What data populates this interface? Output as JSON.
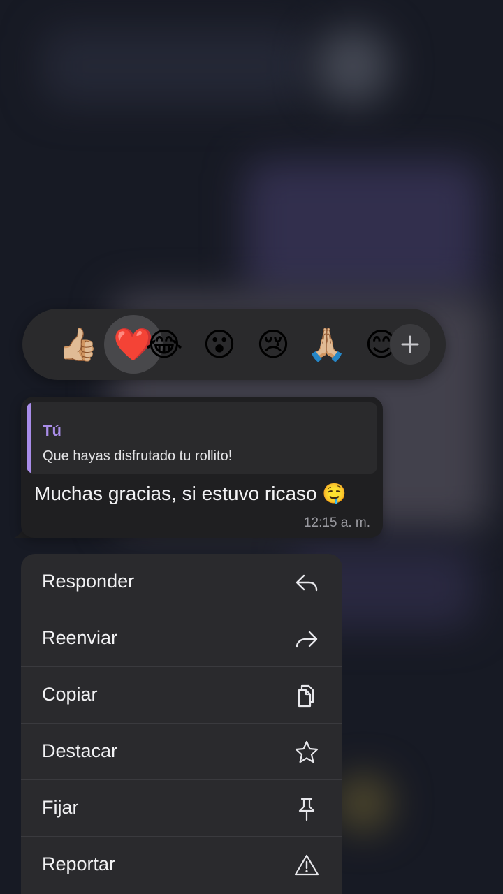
{
  "reactions": {
    "items": [
      {
        "emoji": "👍🏼",
        "name": "thumbs-up-icon",
        "selected": false
      },
      {
        "emoji": "❤️",
        "name": "heart-icon",
        "selected": true
      },
      {
        "emoji": "😂",
        "name": "laughing-icon",
        "selected": false
      },
      {
        "emoji": "😮",
        "name": "surprised-icon",
        "selected": false
      },
      {
        "emoji": "😢",
        "name": "crying-icon",
        "selected": false
      },
      {
        "emoji": "🙏🏼",
        "name": "praying-hands-icon",
        "selected": false
      },
      {
        "emoji": "😊",
        "name": "partial-emoji-icon",
        "selected": false
      }
    ],
    "more_icon": "plus-icon"
  },
  "message": {
    "quote_author": "Tú",
    "quote_text": "Que hayas disfrutado tu rollito!",
    "text": "Muchas gracias, si estuvo ricaso 🤤",
    "time": "12:15 a. m."
  },
  "menu": {
    "items": [
      {
        "label": "Responder",
        "icon": "reply-icon"
      },
      {
        "label": "Reenviar",
        "icon": "forward-icon"
      },
      {
        "label": "Copiar",
        "icon": "copy-icon"
      },
      {
        "label": "Destacar",
        "icon": "star-icon"
      },
      {
        "label": "Fijar",
        "icon": "pin-icon"
      },
      {
        "label": "Reportar",
        "icon": "warning-icon"
      }
    ]
  },
  "colors": {
    "accent": "#a98de8",
    "menu_bg": "#2a2a2d",
    "bubble_bg": "#1f1f21"
  }
}
